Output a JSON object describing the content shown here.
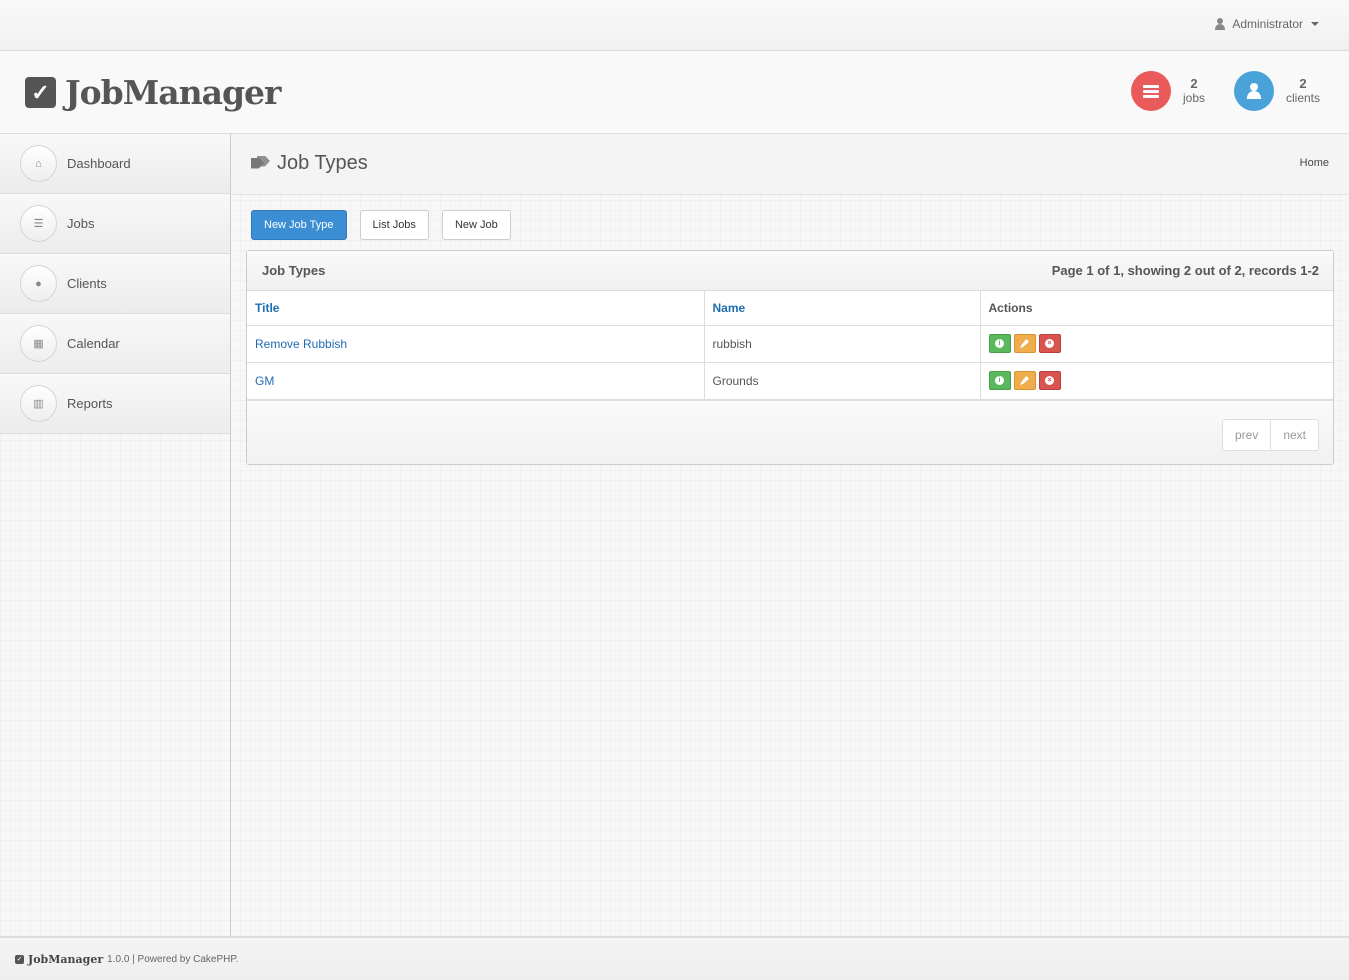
{
  "topbar": {
    "user_label": "Administrator"
  },
  "header": {
    "app_name": "JobManager",
    "stats": [
      {
        "count": "2",
        "label": "jobs",
        "color": "#e95b5b",
        "icon": "list-icon"
      },
      {
        "count": "2",
        "label": "clients",
        "color": "#4aa3d8",
        "icon": "user-icon"
      }
    ]
  },
  "sidebar": {
    "items": [
      {
        "label": "Dashboard",
        "icon": "home-icon"
      },
      {
        "label": "Jobs",
        "icon": "list-icon"
      },
      {
        "label": "Clients",
        "icon": "user-icon"
      },
      {
        "label": "Calendar",
        "icon": "calendar-icon"
      },
      {
        "label": "Reports",
        "icon": "chart-icon"
      }
    ]
  },
  "page": {
    "title": "Job Types",
    "breadcrumb": "Home"
  },
  "toolbar": {
    "new_job_type": "New Job Type",
    "list_jobs": "List Jobs",
    "new_job": "New Job"
  },
  "panel": {
    "title": "Job Types",
    "info": "Page 1 of 1, showing 2 out of 2, records 1-2",
    "columns": [
      "Title",
      "Name",
      "Actions"
    ],
    "rows": [
      {
        "title": "Remove Rubbish",
        "name": "rubbish"
      },
      {
        "title": "GM",
        "name": "Grounds"
      }
    ],
    "pager": {
      "prev": "prev",
      "next": "next"
    }
  },
  "footer": {
    "brand": "JobManager",
    "text": "1.0.0 | Powered by CakePHP."
  },
  "colors": {
    "primary": "#3b8dd4",
    "view": "#5cb85c",
    "edit": "#f0ad4e",
    "delete": "#d9534f",
    "link": "#1f6db0"
  }
}
